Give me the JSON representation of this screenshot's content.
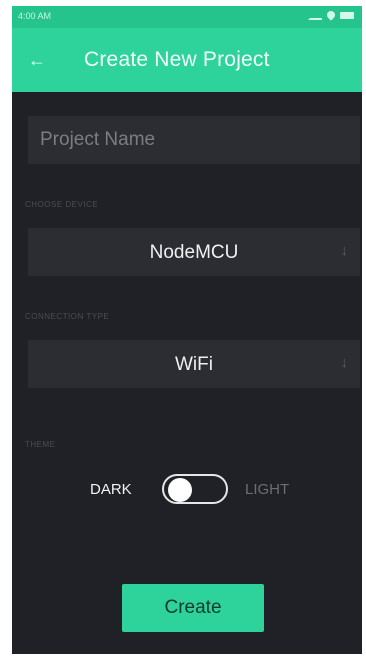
{
  "status_bar": {
    "time": "4:00 AM"
  },
  "app_bar": {
    "back_icon": "back-arrow-icon",
    "title": "Create New Project"
  },
  "form": {
    "project_name_placeholder": "Project Name",
    "choose_device_label": "CHOOSE DEVICE",
    "device_value": "NodeMCU",
    "connection_type_label": "CONNECTION TYPE",
    "connection_value": "WiFi",
    "theme_label": "THEME",
    "theme_dark_label": "DARK",
    "theme_light_label": "LIGHT",
    "theme_selected": "DARK"
  },
  "actions": {
    "create_label": "Create"
  },
  "colors": {
    "accent": "#2dd39a",
    "background": "#1f2126",
    "field_bg": "#2b2d33"
  }
}
